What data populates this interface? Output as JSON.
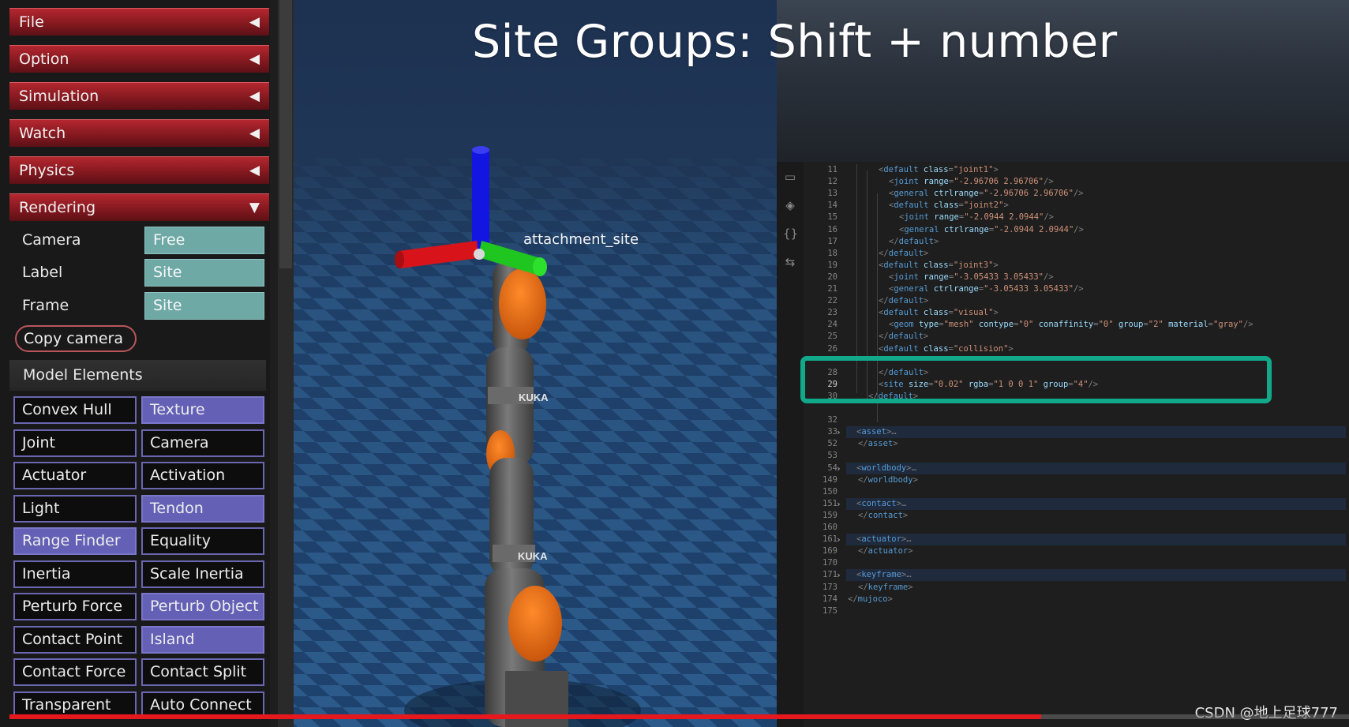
{
  "video": {
    "progress": 0.77
  },
  "title_overlay": "Site Groups: Shift + number",
  "watermark": "CSDN @地上足球777",
  "panel": {
    "sections": [
      {
        "label": "File",
        "arrow": "◀"
      },
      {
        "label": "Option",
        "arrow": "◀"
      },
      {
        "label": "Simulation",
        "arrow": "◀"
      },
      {
        "label": "Watch",
        "arrow": "◀"
      },
      {
        "label": "Physics",
        "arrow": "◀"
      },
      {
        "label": "Rendering",
        "arrow": "▼"
      }
    ],
    "rendering": {
      "camera_label": "Camera",
      "camera_value": "Free",
      "label_label": "Label",
      "label_value": "Site",
      "frame_label": "Frame",
      "frame_value": "Site",
      "copy_camera": "Copy camera"
    },
    "model_elements": {
      "header": "Model Elements",
      "buttons": [
        {
          "label": "Convex Hull",
          "on": false
        },
        {
          "label": "Texture",
          "on": true
        },
        {
          "label": "Joint",
          "on": false
        },
        {
          "label": "Camera",
          "on": false
        },
        {
          "label": "Actuator",
          "on": false
        },
        {
          "label": "Activation",
          "on": false
        },
        {
          "label": "Light",
          "on": false
        },
        {
          "label": "Tendon",
          "on": true
        },
        {
          "label": "Range Finder",
          "on": true
        },
        {
          "label": "Equality",
          "on": false
        },
        {
          "label": "Inertia",
          "on": false
        },
        {
          "label": "Scale Inertia",
          "on": false
        },
        {
          "label": "Perturb Force",
          "on": false
        },
        {
          "label": "Perturb Object",
          "on": true
        },
        {
          "label": "Contact Point",
          "on": false
        },
        {
          "label": "Island",
          "on": true
        },
        {
          "label": "Contact Force",
          "on": false
        },
        {
          "label": "Contact Split",
          "on": false
        },
        {
          "label": "Transparent",
          "on": false
        },
        {
          "label": "Auto Connect",
          "on": false
        }
      ]
    }
  },
  "viewport": {
    "site_label": "attachment_site",
    "robot_brand": "KUKA",
    "colors": {
      "floor_a": "#2d5d8e",
      "floor_b": "#1f4470",
      "sky": "#1f3350",
      "robot": "#5e5e5e",
      "accent": "#e46a14",
      "x_axis": "#e01010",
      "y_axis": "#20c020",
      "z_axis": "#1010e0"
    }
  },
  "editor": {
    "activity_icons": [
      "remote-icon",
      "docker-icon",
      "json-icon",
      "share-icon"
    ],
    "lines": [
      {
        "n": "11",
        "indent": 3,
        "code": [
          [
            "p",
            "<"
          ],
          [
            "t",
            "default"
          ],
          [
            "a",
            " class"
          ],
          [
            "p",
            "="
          ],
          [
            "v",
            "\"joint1\""
          ],
          [
            "p",
            ">"
          ]
        ]
      },
      {
        "n": "12",
        "indent": 4,
        "code": [
          [
            "p",
            "<"
          ],
          [
            "t",
            "joint"
          ],
          [
            "a",
            " range"
          ],
          [
            "p",
            "="
          ],
          [
            "v",
            "\"-2.96706 2.96706\""
          ],
          [
            "p",
            "/>"
          ]
        ]
      },
      {
        "n": "13",
        "indent": 4,
        "code": [
          [
            "p",
            "<"
          ],
          [
            "t",
            "general"
          ],
          [
            "a",
            " ctrlrange"
          ],
          [
            "p",
            "="
          ],
          [
            "v",
            "\"-2.96706 2.96706\""
          ],
          [
            "p",
            "/>"
          ]
        ]
      },
      {
        "n": "14",
        "indent": 4,
        "code": [
          [
            "p",
            "<"
          ],
          [
            "t",
            "default"
          ],
          [
            "a",
            " class"
          ],
          [
            "p",
            "="
          ],
          [
            "v",
            "\"joint2\""
          ],
          [
            "p",
            ">"
          ]
        ]
      },
      {
        "n": "15",
        "indent": 5,
        "code": [
          [
            "p",
            "<"
          ],
          [
            "t",
            "joint"
          ],
          [
            "a",
            " range"
          ],
          [
            "p",
            "="
          ],
          [
            "v",
            "\"-2.0944 2.0944\""
          ],
          [
            "p",
            "/>"
          ]
        ]
      },
      {
        "n": "16",
        "indent": 5,
        "code": [
          [
            "p",
            "<"
          ],
          [
            "t",
            "general"
          ],
          [
            "a",
            " ctrlrange"
          ],
          [
            "p",
            "="
          ],
          [
            "v",
            "\"-2.0944 2.0944\""
          ],
          [
            "p",
            "/>"
          ]
        ]
      },
      {
        "n": "17",
        "indent": 4,
        "code": [
          [
            "p",
            "</"
          ],
          [
            "t",
            "default"
          ],
          [
            "p",
            ">"
          ]
        ]
      },
      {
        "n": "18",
        "indent": 3,
        "code": [
          [
            "p",
            "</"
          ],
          [
            "t",
            "default"
          ],
          [
            "p",
            ">"
          ]
        ]
      },
      {
        "n": "19",
        "indent": 3,
        "code": [
          [
            "p",
            "<"
          ],
          [
            "t",
            "default"
          ],
          [
            "a",
            " class"
          ],
          [
            "p",
            "="
          ],
          [
            "v",
            "\"joint3\""
          ],
          [
            "p",
            ">"
          ]
        ]
      },
      {
        "n": "20",
        "indent": 4,
        "code": [
          [
            "p",
            "<"
          ],
          [
            "t",
            "joint"
          ],
          [
            "a",
            " range"
          ],
          [
            "p",
            "="
          ],
          [
            "v",
            "\"-3.05433 3.05433\""
          ],
          [
            "p",
            "/>"
          ]
        ]
      },
      {
        "n": "21",
        "indent": 4,
        "code": [
          [
            "p",
            "<"
          ],
          [
            "t",
            "general"
          ],
          [
            "a",
            " ctrlrange"
          ],
          [
            "p",
            "="
          ],
          [
            "v",
            "\"-3.05433 3.05433\""
          ],
          [
            "p",
            "/>"
          ]
        ]
      },
      {
        "n": "22",
        "indent": 3,
        "code": [
          [
            "p",
            "</"
          ],
          [
            "t",
            "default"
          ],
          [
            "p",
            ">"
          ]
        ]
      },
      {
        "n": "23",
        "indent": 3,
        "code": [
          [
            "p",
            "<"
          ],
          [
            "t",
            "default"
          ],
          [
            "a",
            " class"
          ],
          [
            "p",
            "="
          ],
          [
            "v",
            "\"visual\""
          ],
          [
            "p",
            ">"
          ]
        ]
      },
      {
        "n": "24",
        "indent": 4,
        "code": [
          [
            "p",
            "<"
          ],
          [
            "t",
            "geom"
          ],
          [
            "a",
            " type"
          ],
          [
            "p",
            "="
          ],
          [
            "v",
            "\"mesh\""
          ],
          [
            "a",
            " contype"
          ],
          [
            "p",
            "="
          ],
          [
            "v",
            "\"0\""
          ],
          [
            "a",
            " conaffinity"
          ],
          [
            "p",
            "="
          ],
          [
            "v",
            "\"0\""
          ],
          [
            "a",
            " group"
          ],
          [
            "p",
            "="
          ],
          [
            "v",
            "\"2\""
          ],
          [
            "a",
            " material"
          ],
          [
            "p",
            "="
          ],
          [
            "v",
            "\"gray\""
          ],
          [
            "p",
            "/>"
          ]
        ]
      },
      {
        "n": "25",
        "indent": 3,
        "code": [
          [
            "p",
            "</"
          ],
          [
            "t",
            "default"
          ],
          [
            "p",
            ">"
          ]
        ]
      },
      {
        "n": "26",
        "indent": 3,
        "code": [
          [
            "p",
            "<"
          ],
          [
            "t",
            "default"
          ],
          [
            "a",
            " class"
          ],
          [
            "p",
            "="
          ],
          [
            "v",
            "\"collision\""
          ],
          [
            "p",
            ">"
          ]
        ]
      },
      {
        "n": "",
        "indent": 0,
        "code": []
      },
      {
        "n": "28",
        "indent": 3,
        "code": [
          [
            "p",
            "</"
          ],
          [
            "t",
            "default"
          ],
          [
            "p",
            ">"
          ]
        ]
      },
      {
        "n": "29",
        "indent": 3,
        "cur": true,
        "code": [
          [
            "p",
            "<"
          ],
          [
            "t",
            "site"
          ],
          [
            "a",
            " size"
          ],
          [
            "p",
            "="
          ],
          [
            "v",
            "\"0.02\""
          ],
          [
            "a",
            " rgba"
          ],
          [
            "p",
            "="
          ],
          [
            "v",
            "\"1 0 0 1\""
          ],
          [
            "a",
            " group"
          ],
          [
            "p",
            "="
          ],
          [
            "v",
            "\"4\""
          ],
          [
            "p",
            "/>"
          ]
        ]
      },
      {
        "n": "30",
        "indent": 2,
        "code": [
          [
            "p",
            "</"
          ],
          [
            "t",
            "default"
          ],
          [
            "p",
            ">"
          ]
        ]
      },
      {
        "n": "",
        "indent": 0,
        "code": []
      },
      {
        "n": "32",
        "indent": 1,
        "code": []
      },
      {
        "n": "33",
        "indent": 1,
        "fold": true,
        "coll": true,
        "code": [
          [
            "p",
            "<"
          ],
          [
            "t",
            "asset"
          ],
          [
            "p",
            ">"
          ],
          [
            "p",
            "…"
          ]
        ]
      },
      {
        "n": "52",
        "indent": 1,
        "code": [
          [
            "p",
            "</"
          ],
          [
            "t",
            "asset"
          ],
          [
            "p",
            ">"
          ]
        ]
      },
      {
        "n": "53",
        "indent": 1,
        "code": []
      },
      {
        "n": "54",
        "indent": 1,
        "fold": true,
        "coll": true,
        "code": [
          [
            "p",
            "<"
          ],
          [
            "t",
            "worldbody"
          ],
          [
            "p",
            ">"
          ],
          [
            "p",
            "…"
          ]
        ]
      },
      {
        "n": "149",
        "indent": 1,
        "code": [
          [
            "p",
            "</"
          ],
          [
            "t",
            "worldbody"
          ],
          [
            "p",
            ">"
          ]
        ]
      },
      {
        "n": "150",
        "indent": 1,
        "code": []
      },
      {
        "n": "151",
        "indent": 1,
        "fold": true,
        "coll": true,
        "code": [
          [
            "p",
            "<"
          ],
          [
            "t",
            "contact"
          ],
          [
            "p",
            ">"
          ],
          [
            "p",
            "…"
          ]
        ]
      },
      {
        "n": "159",
        "indent": 1,
        "code": [
          [
            "p",
            "</"
          ],
          [
            "t",
            "contact"
          ],
          [
            "p",
            ">"
          ]
        ]
      },
      {
        "n": "160",
        "indent": 1,
        "code": []
      },
      {
        "n": "161",
        "indent": 1,
        "fold": true,
        "coll": true,
        "code": [
          [
            "p",
            "<"
          ],
          [
            "t",
            "actuator"
          ],
          [
            "p",
            ">"
          ],
          [
            "p",
            "…"
          ]
        ]
      },
      {
        "n": "169",
        "indent": 1,
        "code": [
          [
            "p",
            "</"
          ],
          [
            "t",
            "actuator"
          ],
          [
            "p",
            ">"
          ]
        ]
      },
      {
        "n": "170",
        "indent": 1,
        "code": []
      },
      {
        "n": "171",
        "indent": 1,
        "fold": true,
        "coll": true,
        "code": [
          [
            "p",
            "<"
          ],
          [
            "t",
            "keyframe"
          ],
          [
            "p",
            ">"
          ],
          [
            "p",
            "…"
          ]
        ]
      },
      {
        "n": "173",
        "indent": 1,
        "code": [
          [
            "p",
            "</"
          ],
          [
            "t",
            "keyframe"
          ],
          [
            "p",
            ">"
          ]
        ]
      },
      {
        "n": "174",
        "indent": 0,
        "code": [
          [
            "p",
            "</"
          ],
          [
            "t",
            "mujoco"
          ],
          [
            "p",
            ">"
          ]
        ]
      },
      {
        "n": "175",
        "indent": 0,
        "code": []
      }
    ]
  }
}
